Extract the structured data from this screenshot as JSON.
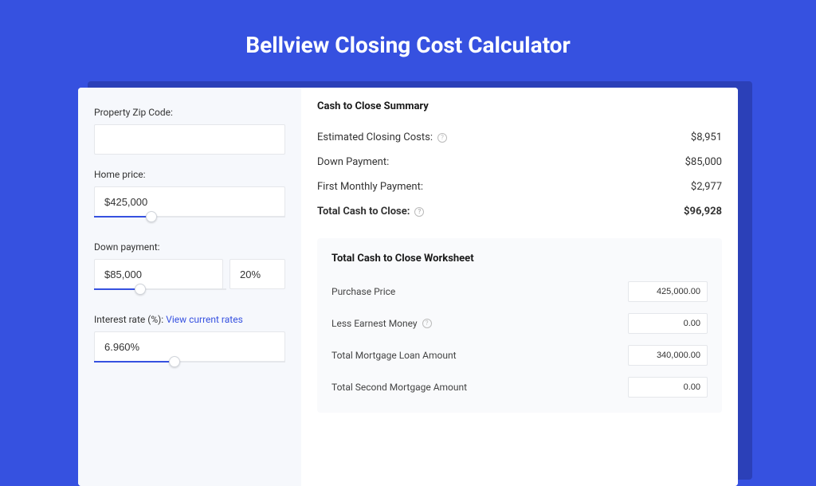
{
  "pageTitle": "Bellview Closing Cost Calculator",
  "left": {
    "zipLabel": "Property Zip Code:",
    "zipValue": "",
    "homePriceLabel": "Home price:",
    "homePriceValue": "$425,000",
    "homePriceSliderPct": 30,
    "downPaymentLabel": "Down payment:",
    "downPaymentValue": "$85,000",
    "downPaymentPctValue": "20%",
    "downPaymentSliderPct": 35,
    "interestRateLabel": "Interest rate (%):",
    "interestRateLinkText": "View current rates",
    "interestRateValue": "6.960%",
    "interestRateSliderPct": 42
  },
  "summary": {
    "title": "Cash to Close Summary",
    "rows": [
      {
        "label": "Estimated Closing Costs:",
        "value": "$8,951",
        "help": true
      },
      {
        "label": "Down Payment:",
        "value": "$85,000",
        "help": false
      },
      {
        "label": "First Monthly Payment:",
        "value": "$2,977",
        "help": false
      }
    ],
    "totalLabel": "Total Cash to Close:",
    "totalValue": "$96,928"
  },
  "worksheet": {
    "title": "Total Cash to Close Worksheet",
    "rows": [
      {
        "label": "Purchase Price",
        "value": "425,000.00",
        "help": false
      },
      {
        "label": "Less Earnest Money",
        "value": "0.00",
        "help": true
      },
      {
        "label": "Total Mortgage Loan Amount",
        "value": "340,000.00",
        "help": false
      },
      {
        "label": "Total Second Mortgage Amount",
        "value": "0.00",
        "help": false
      }
    ]
  }
}
